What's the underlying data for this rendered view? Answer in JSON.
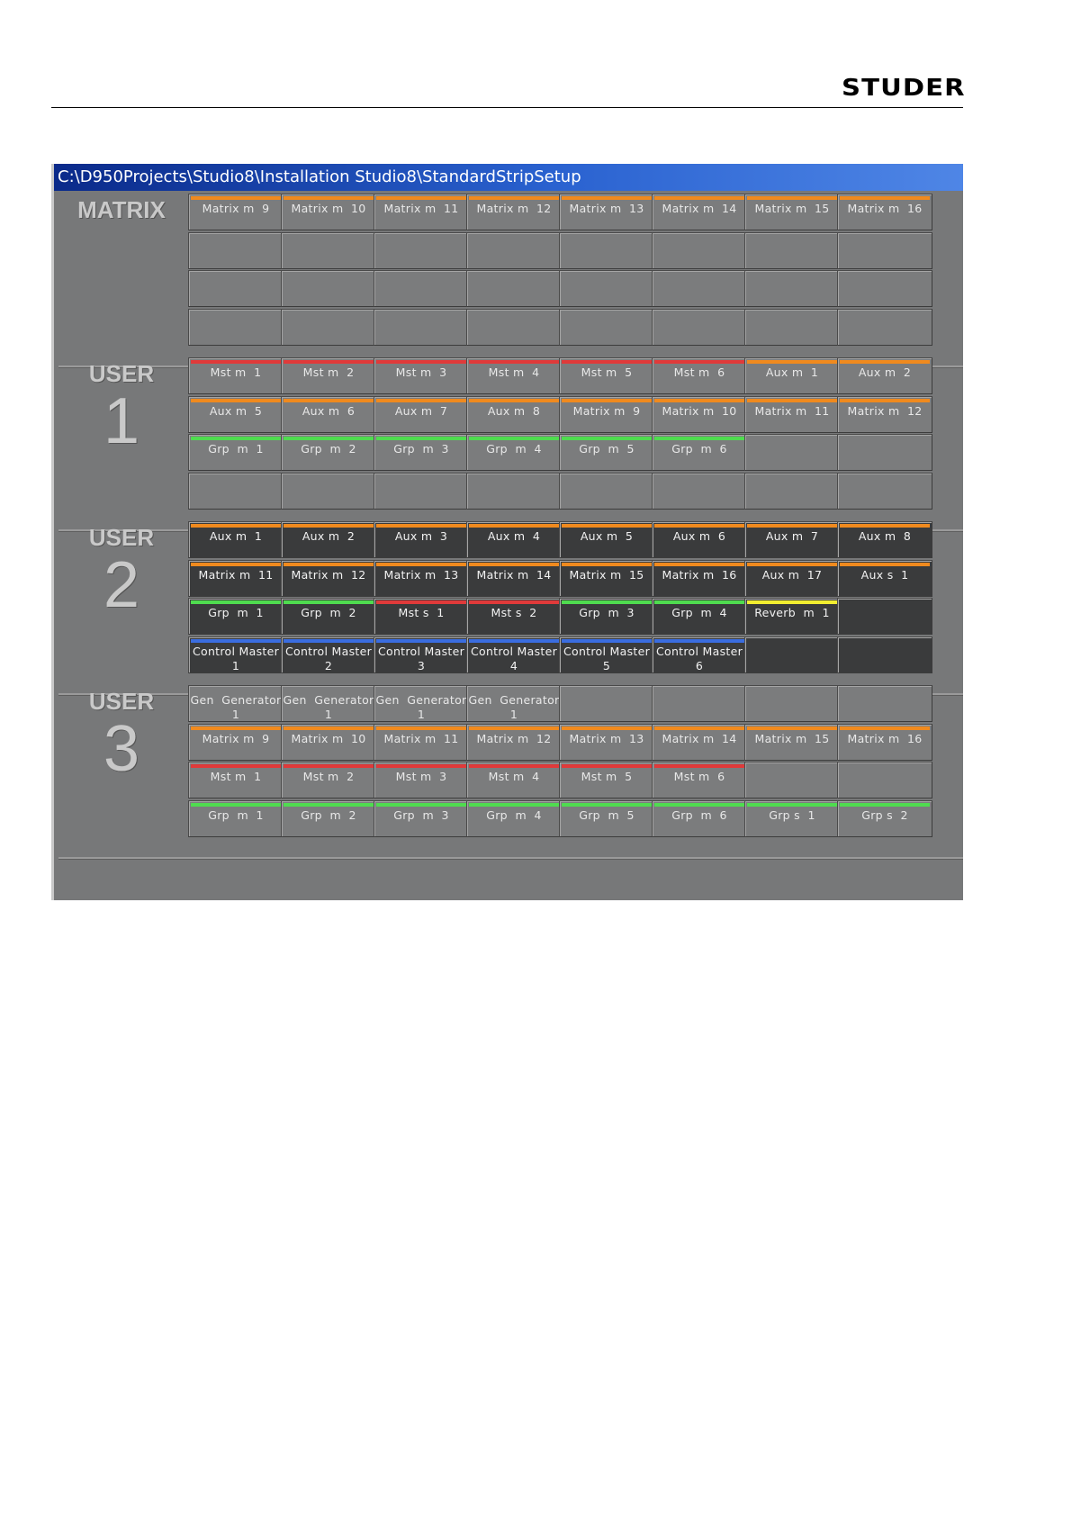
{
  "brand": {
    "logo_text": "STUDER"
  },
  "window": {
    "title": "C:\\D950Projects\\Studio8\\Installation Studio8\\StandardStripSetup"
  },
  "colors": {
    "orange": "#f08a1e",
    "red": "#e03a3a",
    "green": "#4fdc4f",
    "blue": "#3a6de0",
    "yellow": "#f2ee30"
  },
  "sections": [
    {
      "label_word": "MATRIX",
      "label_number": "",
      "rows": [
        [
          {
            "text": "Matrix m  9",
            "bar": "orange",
            "dark": false
          },
          {
            "text": "Matrix m  10",
            "bar": "orange",
            "dark": false
          },
          {
            "text": "Matrix m  11",
            "bar": "orange",
            "dark": false
          },
          {
            "text": "Matrix m  12",
            "bar": "orange",
            "dark": false
          },
          {
            "text": "Matrix m  13",
            "bar": "orange",
            "dark": false
          },
          {
            "text": "Matrix m  14",
            "bar": "orange",
            "dark": false
          },
          {
            "text": "Matrix m  15",
            "bar": "orange",
            "dark": false
          },
          {
            "text": "Matrix m  16",
            "bar": "orange",
            "dark": false
          }
        ],
        [
          {},
          {},
          {},
          {},
          {},
          {},
          {},
          {}
        ],
        [
          {},
          {},
          {},
          {},
          {},
          {},
          {},
          {}
        ],
        [
          {},
          {},
          {},
          {},
          {},
          {},
          {},
          {}
        ]
      ]
    },
    {
      "label_word": "USER",
      "label_number": "1",
      "rows": [
        [
          {
            "text": "Mst m  1",
            "bar": "red",
            "dark": false
          },
          {
            "text": "Mst m  2",
            "bar": "red",
            "dark": false
          },
          {
            "text": "Mst m  3",
            "bar": "red",
            "dark": false
          },
          {
            "text": "Mst m  4",
            "bar": "red",
            "dark": false
          },
          {
            "text": "Mst m  5",
            "bar": "red",
            "dark": false
          },
          {
            "text": "Mst m  6",
            "bar": "red",
            "dark": false
          },
          {
            "text": "Aux m  1",
            "bar": "orange",
            "dark": false
          },
          {
            "text": "Aux m  2",
            "bar": "orange",
            "dark": false
          }
        ],
        [
          {
            "text": "Aux m  5",
            "bar": "orange",
            "dark": false
          },
          {
            "text": "Aux m  6",
            "bar": "orange",
            "dark": false
          },
          {
            "text": "Aux m  7",
            "bar": "orange",
            "dark": false
          },
          {
            "text": "Aux m  8",
            "bar": "orange",
            "dark": false
          },
          {
            "text": "Matrix m  9",
            "bar": "orange",
            "dark": false
          },
          {
            "text": "Matrix m  10",
            "bar": "orange",
            "dark": false
          },
          {
            "text": "Matrix m  11",
            "bar": "orange",
            "dark": false
          },
          {
            "text": "Matrix m  12",
            "bar": "orange",
            "dark": false
          }
        ],
        [
          {
            "text": "Grp  m  1",
            "bar": "green",
            "dark": false
          },
          {
            "text": "Grp  m  2",
            "bar": "green",
            "dark": false
          },
          {
            "text": "Grp  m  3",
            "bar": "green",
            "dark": false
          },
          {
            "text": "Grp  m  4",
            "bar": "green",
            "dark": false
          },
          {
            "text": "Grp  m  5",
            "bar": "green",
            "dark": false
          },
          {
            "text": "Grp  m  6",
            "bar": "green",
            "dark": false
          },
          {},
          {}
        ],
        [
          {},
          {},
          {},
          {},
          {},
          {},
          {},
          {}
        ]
      ]
    },
    {
      "label_word": "USER",
      "label_number": "2",
      "rows": [
        [
          {
            "text": "Aux m  1",
            "bar": "orange",
            "dark": true
          },
          {
            "text": "Aux m  2",
            "bar": "orange",
            "dark": true
          },
          {
            "text": "Aux m  3",
            "bar": "orange",
            "dark": true
          },
          {
            "text": "Aux m  4",
            "bar": "orange",
            "dark": true
          },
          {
            "text": "Aux m  5",
            "bar": "orange",
            "dark": true
          },
          {
            "text": "Aux m  6",
            "bar": "orange",
            "dark": true
          },
          {
            "text": "Aux m  7",
            "bar": "orange",
            "dark": true
          },
          {
            "text": "Aux m  8",
            "bar": "orange",
            "dark": true
          }
        ],
        [
          {
            "text": "Matrix m  11",
            "bar": "orange",
            "dark": true
          },
          {
            "text": "Matrix m  12",
            "bar": "orange",
            "dark": true
          },
          {
            "text": "Matrix m  13",
            "bar": "orange",
            "dark": true
          },
          {
            "text": "Matrix m  14",
            "bar": "orange",
            "dark": true
          },
          {
            "text": "Matrix m  15",
            "bar": "orange",
            "dark": true
          },
          {
            "text": "Matrix m  16",
            "bar": "orange",
            "dark": true
          },
          {
            "text": "Aux m  17",
            "bar": "orange",
            "dark": true
          },
          {
            "text": "Aux s  1",
            "bar": "orange",
            "dark": true
          }
        ],
        [
          {
            "text": "Grp  m  1",
            "bar": "green",
            "dark": true
          },
          {
            "text": "Grp  m  2",
            "bar": "green",
            "dark": true
          },
          {
            "text": "Mst s  1",
            "bar": "red",
            "dark": true
          },
          {
            "text": "Mst s  2",
            "bar": "red",
            "dark": true
          },
          {
            "text": "Grp  m  3",
            "bar": "green",
            "dark": true
          },
          {
            "text": "Grp  m  4",
            "bar": "green",
            "dark": true
          },
          {
            "text": "Reverb  m  1",
            "bar": "yellow",
            "dark": true
          },
          {
            "dark": true
          }
        ],
        [
          {
            "text": "Control Master\n1",
            "bar": "blue",
            "dark": true
          },
          {
            "text": "Control Master\n2",
            "bar": "blue",
            "dark": true
          },
          {
            "text": "Control Master\n3",
            "bar": "blue",
            "dark": true
          },
          {
            "text": "Control Master\n4",
            "bar": "blue",
            "dark": true
          },
          {
            "text": "Control Master\n5",
            "bar": "blue",
            "dark": true
          },
          {
            "text": "Control Master\n6",
            "bar": "blue",
            "dark": true
          },
          {
            "dark": true
          },
          {
            "dark": true
          }
        ]
      ]
    },
    {
      "label_word": "USER",
      "label_number": "3",
      "rows": [
        [
          {
            "text": "Gen  Generator\n1",
            "bar": "",
            "dark": false
          },
          {
            "text": "Gen  Generator\n1",
            "bar": "",
            "dark": false
          },
          {
            "text": "Gen  Generator\n1",
            "bar": "",
            "dark": false
          },
          {
            "text": "Gen  Generator\n1",
            "bar": "",
            "dark": false
          },
          {},
          {},
          {},
          {}
        ],
        [
          {
            "text": "Matrix m  9",
            "bar": "orange",
            "dark": false
          },
          {
            "text": "Matrix m  10",
            "bar": "orange",
            "dark": false
          },
          {
            "text": "Matrix m  11",
            "bar": "orange",
            "dark": false
          },
          {
            "text": "Matrix m  12",
            "bar": "orange",
            "dark": false
          },
          {
            "text": "Matrix m  13",
            "bar": "orange",
            "dark": false
          },
          {
            "text": "Matrix m  14",
            "bar": "orange",
            "dark": false
          },
          {
            "text": "Matrix m  15",
            "bar": "orange",
            "dark": false
          },
          {
            "text": "Matrix m  16",
            "bar": "orange",
            "dark": false
          }
        ],
        [
          {
            "text": "Mst m  1",
            "bar": "red",
            "dark": false
          },
          {
            "text": "Mst m  2",
            "bar": "red",
            "dark": false
          },
          {
            "text": "Mst m  3",
            "bar": "red",
            "dark": false
          },
          {
            "text": "Mst m  4",
            "bar": "red",
            "dark": false
          },
          {
            "text": "Mst m  5",
            "bar": "red",
            "dark": false
          },
          {
            "text": "Mst m  6",
            "bar": "red",
            "dark": false
          },
          {},
          {}
        ],
        [
          {
            "text": "Grp  m  1",
            "bar": "green",
            "dark": false
          },
          {
            "text": "Grp  m  2",
            "bar": "green",
            "dark": false
          },
          {
            "text": "Grp  m  3",
            "bar": "green",
            "dark": false
          },
          {
            "text": "Grp  m  4",
            "bar": "green",
            "dark": false
          },
          {
            "text": "Grp  m  5",
            "bar": "green",
            "dark": false
          },
          {
            "text": "Grp  m  6",
            "bar": "green",
            "dark": false
          },
          {
            "text": "Grp s  1",
            "bar": "green",
            "dark": false
          },
          {
            "text": "Grp s  2",
            "bar": "green",
            "dark": false
          }
        ]
      ]
    }
  ]
}
